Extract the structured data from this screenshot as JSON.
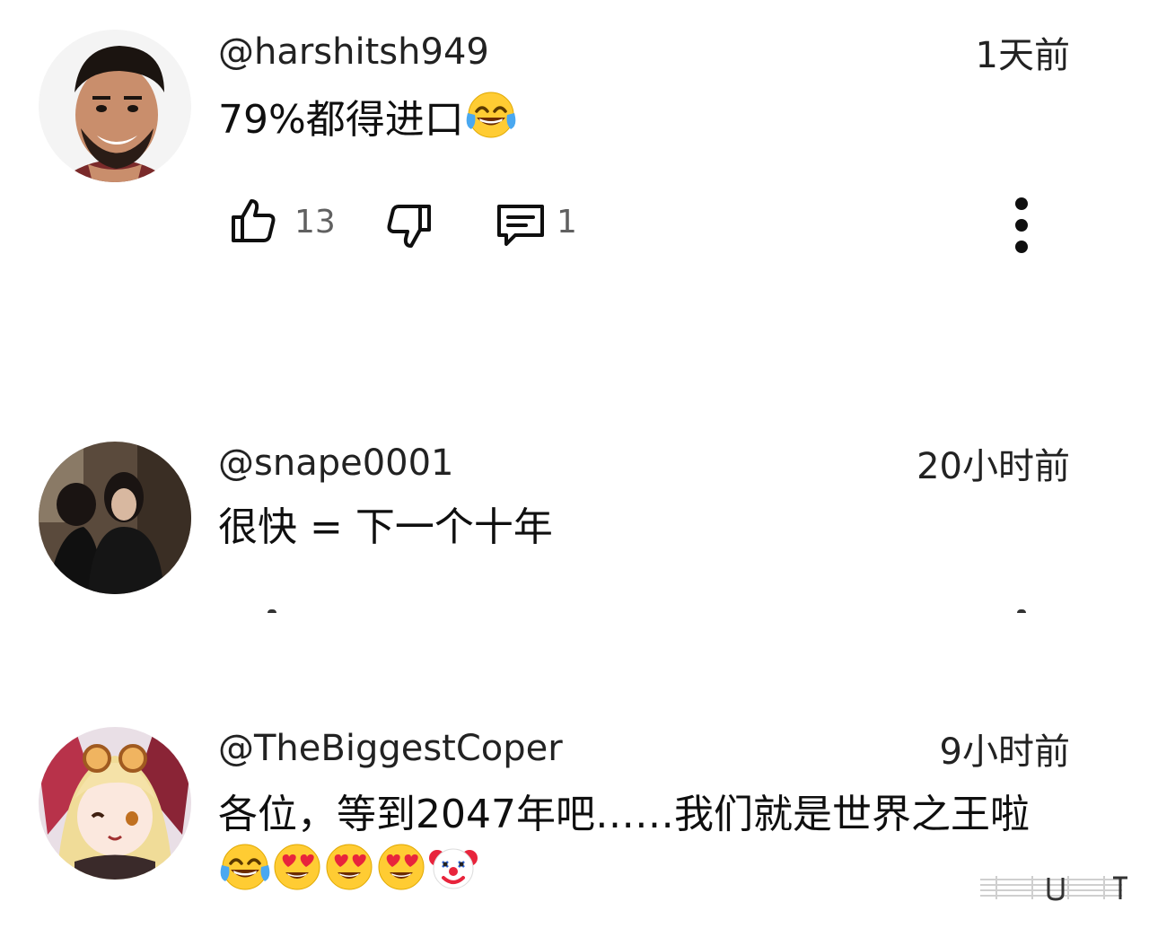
{
  "comments": [
    {
      "handle": "@harshitsh949",
      "time": "1天前",
      "text": "79%都得进口",
      "emojis": [
        "face-with-tears-of-joy-emoji"
      ],
      "likes": "13",
      "replies": "1"
    },
    {
      "handle": "@snape0001",
      "time": "20小时前",
      "text": "很快 = 下一个十年"
    },
    {
      "handle": "@TheBiggestCoper",
      "time": "9小时前",
      "text": "各位，等到2047年吧……我们就是世界之王啦",
      "emojis": [
        "face-with-tears-of-joy-emoji",
        "heart-eyes-emoji",
        "heart-eyes-emoji",
        "heart-eyes-emoji",
        "clown-face-emoji"
      ]
    }
  ],
  "icons": {
    "like": "thumbs-up-icon",
    "dislike": "thumbs-down-icon",
    "reply": "comment-icon",
    "more": "more-vert-icon"
  },
  "colors": {
    "text": "#0f0f0f",
    "secondary": "#606060",
    "background": "#ffffff"
  }
}
